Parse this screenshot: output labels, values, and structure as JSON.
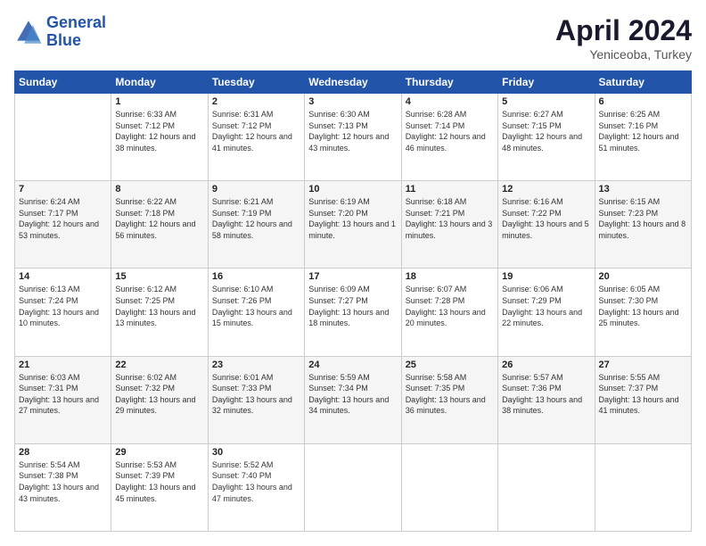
{
  "header": {
    "logo_line1": "General",
    "logo_line2": "Blue",
    "month_title": "April 2024",
    "location": "Yeniceoba, Turkey"
  },
  "weekdays": [
    "Sunday",
    "Monday",
    "Tuesday",
    "Wednesday",
    "Thursday",
    "Friday",
    "Saturday"
  ],
  "weeks": [
    [
      {
        "day": "",
        "sunrise": "",
        "sunset": "",
        "daylight": ""
      },
      {
        "day": "1",
        "sunrise": "Sunrise: 6:33 AM",
        "sunset": "Sunset: 7:12 PM",
        "daylight": "Daylight: 12 hours and 38 minutes."
      },
      {
        "day": "2",
        "sunrise": "Sunrise: 6:31 AM",
        "sunset": "Sunset: 7:12 PM",
        "daylight": "Daylight: 12 hours and 41 minutes."
      },
      {
        "day": "3",
        "sunrise": "Sunrise: 6:30 AM",
        "sunset": "Sunset: 7:13 PM",
        "daylight": "Daylight: 12 hours and 43 minutes."
      },
      {
        "day": "4",
        "sunrise": "Sunrise: 6:28 AM",
        "sunset": "Sunset: 7:14 PM",
        "daylight": "Daylight: 12 hours and 46 minutes."
      },
      {
        "day": "5",
        "sunrise": "Sunrise: 6:27 AM",
        "sunset": "Sunset: 7:15 PM",
        "daylight": "Daylight: 12 hours and 48 minutes."
      },
      {
        "day": "6",
        "sunrise": "Sunrise: 6:25 AM",
        "sunset": "Sunset: 7:16 PM",
        "daylight": "Daylight: 12 hours and 51 minutes."
      }
    ],
    [
      {
        "day": "7",
        "sunrise": "Sunrise: 6:24 AM",
        "sunset": "Sunset: 7:17 PM",
        "daylight": "Daylight: 12 hours and 53 minutes."
      },
      {
        "day": "8",
        "sunrise": "Sunrise: 6:22 AM",
        "sunset": "Sunset: 7:18 PM",
        "daylight": "Daylight: 12 hours and 56 minutes."
      },
      {
        "day": "9",
        "sunrise": "Sunrise: 6:21 AM",
        "sunset": "Sunset: 7:19 PM",
        "daylight": "Daylight: 12 hours and 58 minutes."
      },
      {
        "day": "10",
        "sunrise": "Sunrise: 6:19 AM",
        "sunset": "Sunset: 7:20 PM",
        "daylight": "Daylight: 13 hours and 1 minute."
      },
      {
        "day": "11",
        "sunrise": "Sunrise: 6:18 AM",
        "sunset": "Sunset: 7:21 PM",
        "daylight": "Daylight: 13 hours and 3 minutes."
      },
      {
        "day": "12",
        "sunrise": "Sunrise: 6:16 AM",
        "sunset": "Sunset: 7:22 PM",
        "daylight": "Daylight: 13 hours and 5 minutes."
      },
      {
        "day": "13",
        "sunrise": "Sunrise: 6:15 AM",
        "sunset": "Sunset: 7:23 PM",
        "daylight": "Daylight: 13 hours and 8 minutes."
      }
    ],
    [
      {
        "day": "14",
        "sunrise": "Sunrise: 6:13 AM",
        "sunset": "Sunset: 7:24 PM",
        "daylight": "Daylight: 13 hours and 10 minutes."
      },
      {
        "day": "15",
        "sunrise": "Sunrise: 6:12 AM",
        "sunset": "Sunset: 7:25 PM",
        "daylight": "Daylight: 13 hours and 13 minutes."
      },
      {
        "day": "16",
        "sunrise": "Sunrise: 6:10 AM",
        "sunset": "Sunset: 7:26 PM",
        "daylight": "Daylight: 13 hours and 15 minutes."
      },
      {
        "day": "17",
        "sunrise": "Sunrise: 6:09 AM",
        "sunset": "Sunset: 7:27 PM",
        "daylight": "Daylight: 13 hours and 18 minutes."
      },
      {
        "day": "18",
        "sunrise": "Sunrise: 6:07 AM",
        "sunset": "Sunset: 7:28 PM",
        "daylight": "Daylight: 13 hours and 20 minutes."
      },
      {
        "day": "19",
        "sunrise": "Sunrise: 6:06 AM",
        "sunset": "Sunset: 7:29 PM",
        "daylight": "Daylight: 13 hours and 22 minutes."
      },
      {
        "day": "20",
        "sunrise": "Sunrise: 6:05 AM",
        "sunset": "Sunset: 7:30 PM",
        "daylight": "Daylight: 13 hours and 25 minutes."
      }
    ],
    [
      {
        "day": "21",
        "sunrise": "Sunrise: 6:03 AM",
        "sunset": "Sunset: 7:31 PM",
        "daylight": "Daylight: 13 hours and 27 minutes."
      },
      {
        "day": "22",
        "sunrise": "Sunrise: 6:02 AM",
        "sunset": "Sunset: 7:32 PM",
        "daylight": "Daylight: 13 hours and 29 minutes."
      },
      {
        "day": "23",
        "sunrise": "Sunrise: 6:01 AM",
        "sunset": "Sunset: 7:33 PM",
        "daylight": "Daylight: 13 hours and 32 minutes."
      },
      {
        "day": "24",
        "sunrise": "Sunrise: 5:59 AM",
        "sunset": "Sunset: 7:34 PM",
        "daylight": "Daylight: 13 hours and 34 minutes."
      },
      {
        "day": "25",
        "sunrise": "Sunrise: 5:58 AM",
        "sunset": "Sunset: 7:35 PM",
        "daylight": "Daylight: 13 hours and 36 minutes."
      },
      {
        "day": "26",
        "sunrise": "Sunrise: 5:57 AM",
        "sunset": "Sunset: 7:36 PM",
        "daylight": "Daylight: 13 hours and 38 minutes."
      },
      {
        "day": "27",
        "sunrise": "Sunrise: 5:55 AM",
        "sunset": "Sunset: 7:37 PM",
        "daylight": "Daylight: 13 hours and 41 minutes."
      }
    ],
    [
      {
        "day": "28",
        "sunrise": "Sunrise: 5:54 AM",
        "sunset": "Sunset: 7:38 PM",
        "daylight": "Daylight: 13 hours and 43 minutes."
      },
      {
        "day": "29",
        "sunrise": "Sunrise: 5:53 AM",
        "sunset": "Sunset: 7:39 PM",
        "daylight": "Daylight: 13 hours and 45 minutes."
      },
      {
        "day": "30",
        "sunrise": "Sunrise: 5:52 AM",
        "sunset": "Sunset: 7:40 PM",
        "daylight": "Daylight: 13 hours and 47 minutes."
      },
      {
        "day": "",
        "sunrise": "",
        "sunset": "",
        "daylight": ""
      },
      {
        "day": "",
        "sunrise": "",
        "sunset": "",
        "daylight": ""
      },
      {
        "day": "",
        "sunrise": "",
        "sunset": "",
        "daylight": ""
      },
      {
        "day": "",
        "sunrise": "",
        "sunset": "",
        "daylight": ""
      }
    ]
  ]
}
